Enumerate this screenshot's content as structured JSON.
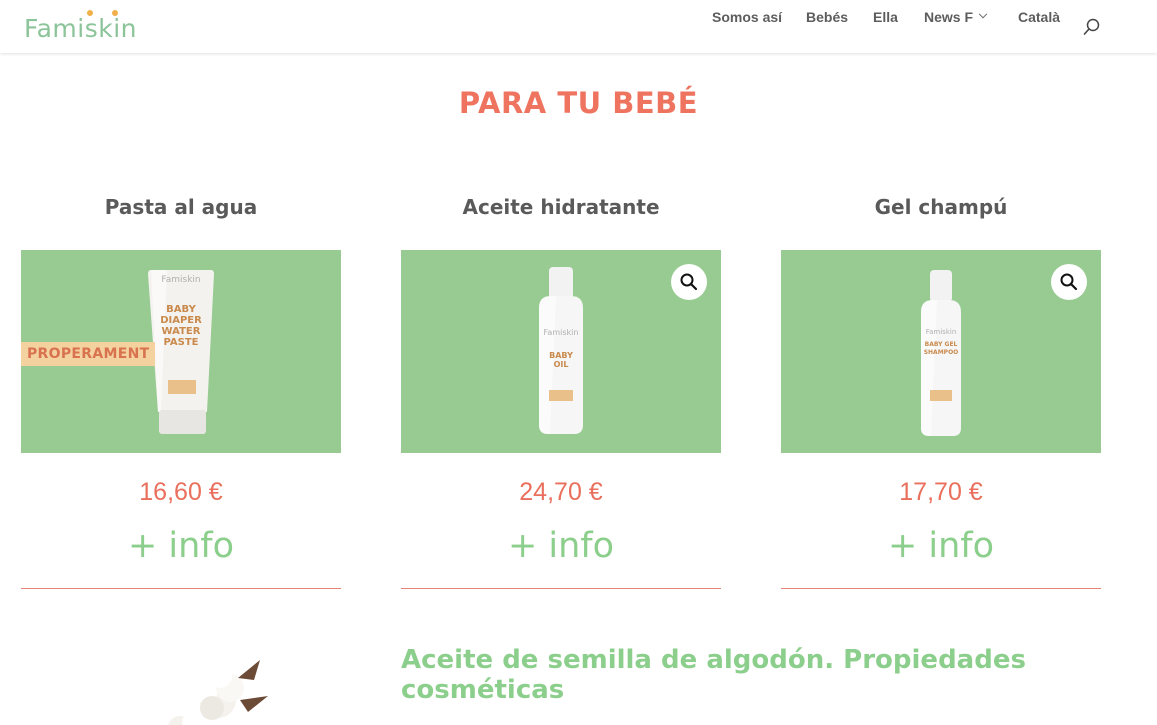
{
  "header": {
    "logo": "Famiskin",
    "nav": [
      "Somos así",
      "Bebés",
      "Ella",
      "News F",
      "Català"
    ],
    "search_icon": "search-icon"
  },
  "section": {
    "title": "PARA TU BEBÉ"
  },
  "products": [
    {
      "title": "Pasta al agua",
      "badge": "PROPERAMENT",
      "package_brand": "Famiskin",
      "package_name": "BABY DIAPER WATER PASTE",
      "price": "16,60 €",
      "info": "+ info"
    },
    {
      "title": "Aceite hidratante",
      "package_brand": "Famiskin",
      "package_name": "BABY OIL",
      "price": "24,70 €",
      "info": "+ info",
      "zoom_icon": "zoom-icon"
    },
    {
      "title": "Gel champú",
      "package_brand": "Famiskin",
      "package_name": "BABY GEL SHAMPOO",
      "price": "17,70 €",
      "info": "+ info",
      "zoom_icon": "zoom-icon"
    }
  ],
  "article": {
    "title": "Aceite de semilla de algodón. Propiedades cosméticas"
  },
  "colors": {
    "accent": "#ef7460",
    "green": "#98cb91",
    "link_green": "#8ccf8c"
  }
}
